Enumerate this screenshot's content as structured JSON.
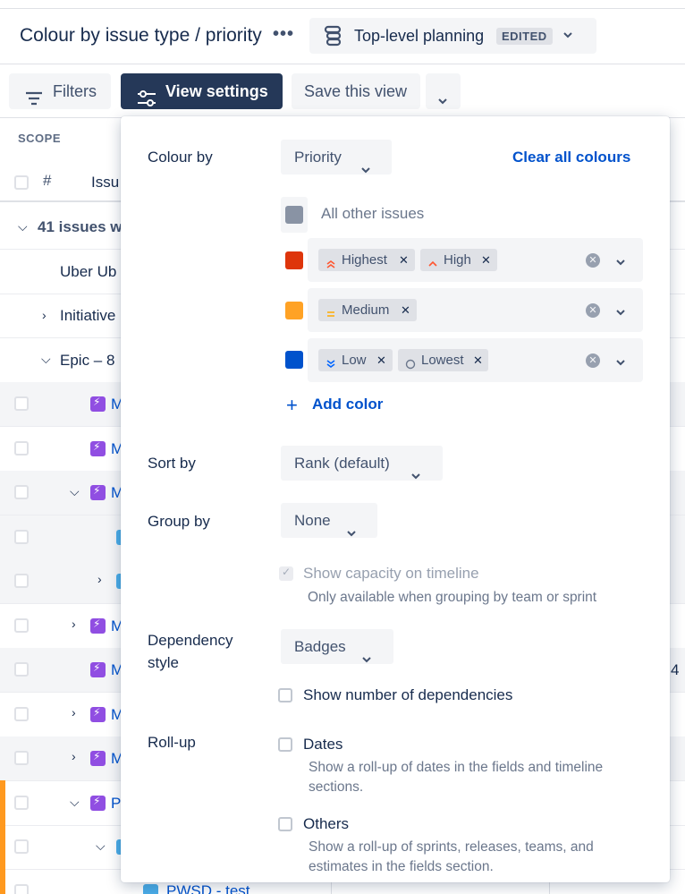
{
  "header": {
    "title": "Colour by issue type / priority",
    "more_label": "•••",
    "plan_name": "Top-level planning",
    "plan_badge": "EDITED"
  },
  "toolbar": {
    "filters_label": "Filters",
    "view_settings_label": "View settings",
    "save_view_label": "Save this view"
  },
  "grid": {
    "scope_label": "SCOPE",
    "hash_label": "#",
    "issue_col_label": "Issu",
    "group_label": "41 issues w",
    "rows": [
      {
        "text": "Uber Ub"
      },
      {
        "text": "Initiative"
      },
      {
        "text": "Epic – 8"
      },
      {
        "text": "M"
      },
      {
        "text": "M"
      },
      {
        "text": "M"
      },
      {
        "text": ""
      },
      {
        "text": ""
      },
      {
        "text": "M"
      },
      {
        "text": "M"
      },
      {
        "text": "M"
      },
      {
        "text": "M"
      },
      {
        "text": "P"
      },
      {
        "text": ""
      },
      {
        "text": "PWSD - test"
      }
    ],
    "right_edge_digit": "4"
  },
  "popup": {
    "colour_by_label": "Colour by",
    "colour_by_value": "Priority",
    "clear_all_label": "Clear all colours",
    "other_issues_label": "All other issues",
    "other_issues_color": "#8993a4",
    "colour_rows": [
      {
        "color": "#de350b",
        "chips": [
          {
            "label": "Highest",
            "icon": "priority-highest-icon"
          },
          {
            "label": "High",
            "icon": "priority-high-icon"
          }
        ]
      },
      {
        "color": "#ffa225",
        "chips": [
          {
            "label": "Medium",
            "icon": "priority-medium-icon"
          }
        ]
      },
      {
        "color": "#0052cc",
        "chips": [
          {
            "label": "Low",
            "icon": "priority-low-icon"
          },
          {
            "label": "Lowest",
            "icon": "priority-lowest-icon"
          }
        ]
      }
    ],
    "add_color_label": "Add color",
    "sort_by_label": "Sort by",
    "sort_by_value": "Rank (default)",
    "group_by_label": "Group by",
    "group_by_value": "None",
    "capacity_label": "Show capacity on timeline",
    "capacity_desc": "Only available when grouping by team or sprint",
    "dependency_label_1": "Dependency",
    "dependency_label_2": "style",
    "dependency_value": "Badges",
    "show_deps_label": "Show number of dependencies",
    "rollup_label": "Roll-up",
    "dates_label": "Dates",
    "dates_desc_1": "Show a roll-up of dates in the fields and timeline",
    "dates_desc_2": "sections.",
    "others_label": "Others",
    "others_desc_1": "Show a roll-up of sprints, releases, teams, and",
    "others_desc_2": "estimates in the fields section."
  }
}
